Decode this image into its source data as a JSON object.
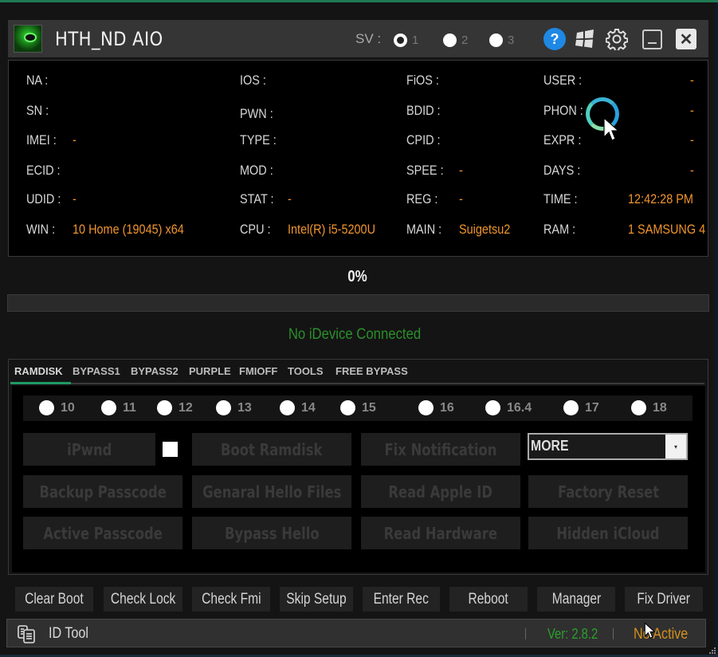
{
  "window": {
    "title": "HTH_ND AIO",
    "sv_label": "SV :",
    "sv_options": [
      {
        "label": "1",
        "selected": true
      },
      {
        "label": "2",
        "selected": false
      },
      {
        "label": "3",
        "selected": false
      }
    ],
    "icons": [
      "help-icon",
      "windows-icon",
      "gear-icon",
      "minimize-icon",
      "close-icon"
    ],
    "help_glyph": "?",
    "close_glyph": "✕"
  },
  "device_info": {
    "col1": [
      {
        "label": "NA :",
        "value": ""
      },
      {
        "label": "SN :",
        "value": ""
      },
      {
        "label": "IMEI :",
        "value": "-"
      },
      {
        "label": "ECID :",
        "value": ""
      },
      {
        "label": "UDID :",
        "value": "-"
      },
      {
        "label": "WIN :",
        "value": "10 Home (19045)  x64"
      }
    ],
    "col2": [
      {
        "label": "IOS :",
        "value": ""
      },
      {
        "label": "PWN :",
        "value": ""
      },
      {
        "label": "TYPE :",
        "value": ""
      },
      {
        "label": "MOD :",
        "value": ""
      },
      {
        "label": "STAT :",
        "value": "-"
      },
      {
        "label": "CPU :",
        "value": "Intel(R) i5-5200U"
      }
    ],
    "col3": [
      {
        "label": "FiOS :",
        "value": ""
      },
      {
        "label": "BDID :",
        "value": ""
      },
      {
        "label": "CPID :",
        "value": ""
      },
      {
        "label": "SPEE :",
        "value": "-"
      },
      {
        "label": "REG :",
        "value": "-"
      },
      {
        "label": "MAIN :",
        "value": "Suigetsu2"
      }
    ],
    "col4": [
      {
        "label": "USER :",
        "value": "-"
      },
      {
        "label": "PHON :",
        "value": "-"
      },
      {
        "label": "EXPR :",
        "value": "-"
      },
      {
        "label": "DAYS :",
        "value": "-"
      },
      {
        "label": "TIME :",
        "value": "12:42:28 PM"
      },
      {
        "label": "RAM :",
        "value": "1 SAMSUNG 4"
      }
    ]
  },
  "progress": {
    "percent_label": "0%",
    "value": 0
  },
  "status": {
    "message": "No iDevice Connected",
    "color": "#2a8f2a"
  },
  "tabs": [
    {
      "label": "RAMDISK",
      "active": true
    },
    {
      "label": "BYPASS1",
      "active": false
    },
    {
      "label": "BYPASS2",
      "active": false
    },
    {
      "label": "PURPLE",
      "active": false
    },
    {
      "label": "FMIOFF",
      "active": false
    },
    {
      "label": "TOOLS",
      "active": false
    },
    {
      "label": "FREE BYPASS",
      "active": false
    }
  ],
  "ramdisk": {
    "versions": [
      "10",
      "11",
      "12",
      "13",
      "14",
      "15",
      "16",
      "16.4",
      "17",
      "18"
    ],
    "buttons": {
      "ipwnd": "iPwnd",
      "boot_ramdisk": "Boot Ramdisk",
      "fix_notification": "Fix Notification",
      "backup_passcode": "Backup Passcode",
      "general_hello_files": "Genaral Hello Files",
      "read_apple_id": "Read Apple ID",
      "factory_reset": "Factory Reset",
      "active_passcode": "Active Passcode",
      "bypass_hello": "Bypass Hello",
      "read_hardware": "Read Hardware",
      "hidden_icloud": "Hidden iCloud"
    },
    "ipwnd_checkbox_checked": false,
    "more_select": {
      "value": "MORE",
      "arrow": "▾"
    }
  },
  "actions": [
    "Clear Boot",
    "Check Lock",
    "Check Fmi",
    "Skip Setup",
    "Enter Rec",
    "Reboot",
    "Manager",
    "Fix Driver"
  ],
  "statusbar": {
    "tool_label": "ID Tool",
    "version": "Ver: 2.8.2",
    "activation": "No Active"
  },
  "colors": {
    "accent_green": "#1f9a63",
    "value_orange": "#f0952e",
    "version_green": "#2aa12a",
    "activation_orange": "#d4901c",
    "help_blue": "#1e88e5"
  }
}
